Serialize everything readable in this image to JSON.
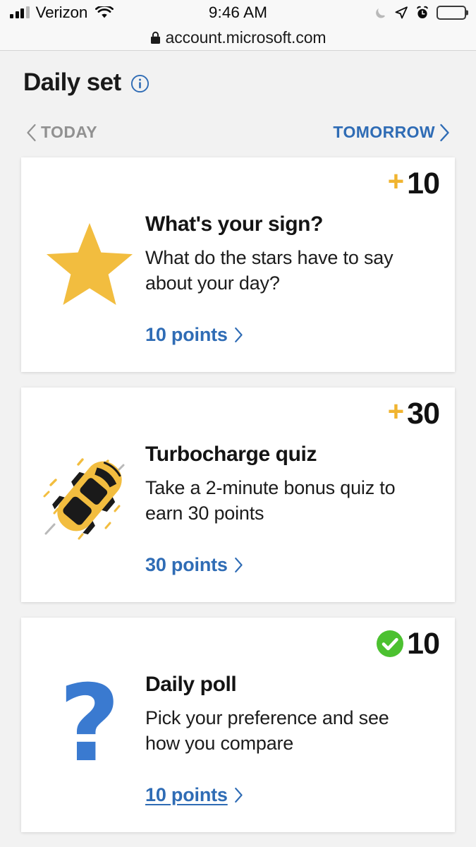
{
  "status_bar": {
    "carrier": "Verizon",
    "time": "9:46 AM",
    "icons": {
      "signal": "signal-bars-icon",
      "wifi": "wifi-icon",
      "dnd": "moon-icon",
      "location": "location-arrow-icon",
      "alarm": "alarm-clock-icon",
      "battery": "battery-icon"
    }
  },
  "url_bar": {
    "lock": "lock-icon",
    "url": "account.microsoft.com"
  },
  "header": {
    "title": "Daily set",
    "info_icon": "info-icon"
  },
  "day_nav": {
    "prev_label": "TODAY",
    "next_label": "TOMORROW"
  },
  "cards": [
    {
      "badge_symbol": "+",
      "badge_type": "plus",
      "badge_value": "10",
      "icon": "star-icon",
      "title": "What's your sign?",
      "description": "What do the stars have to say about your day?",
      "link_label": "10 points",
      "link_underlined": false
    },
    {
      "badge_symbol": "+",
      "badge_type": "plus",
      "badge_value": "30",
      "icon": "race-car-icon",
      "title": "Turbocharge quiz",
      "description": "Take a 2-minute bonus quiz to earn 30 points",
      "link_label": "30 points",
      "link_underlined": false
    },
    {
      "badge_symbol": "✓",
      "badge_type": "check",
      "badge_value": "10",
      "icon": "question-mark-icon",
      "title": "Daily poll",
      "description": "Pick your preference and see how you compare",
      "link_label": "10 points",
      "link_underlined": true
    }
  ],
  "colors": {
    "accent_blue": "#2f6cb5",
    "gold": "#f0b430",
    "star_gold": "#f2bd3f",
    "green_complete": "#4cc130",
    "question_blue": "#3a7ad0",
    "page_bg": "#f2f2f2",
    "card_bg": "#ffffff",
    "muted_gray": "#919191"
  }
}
